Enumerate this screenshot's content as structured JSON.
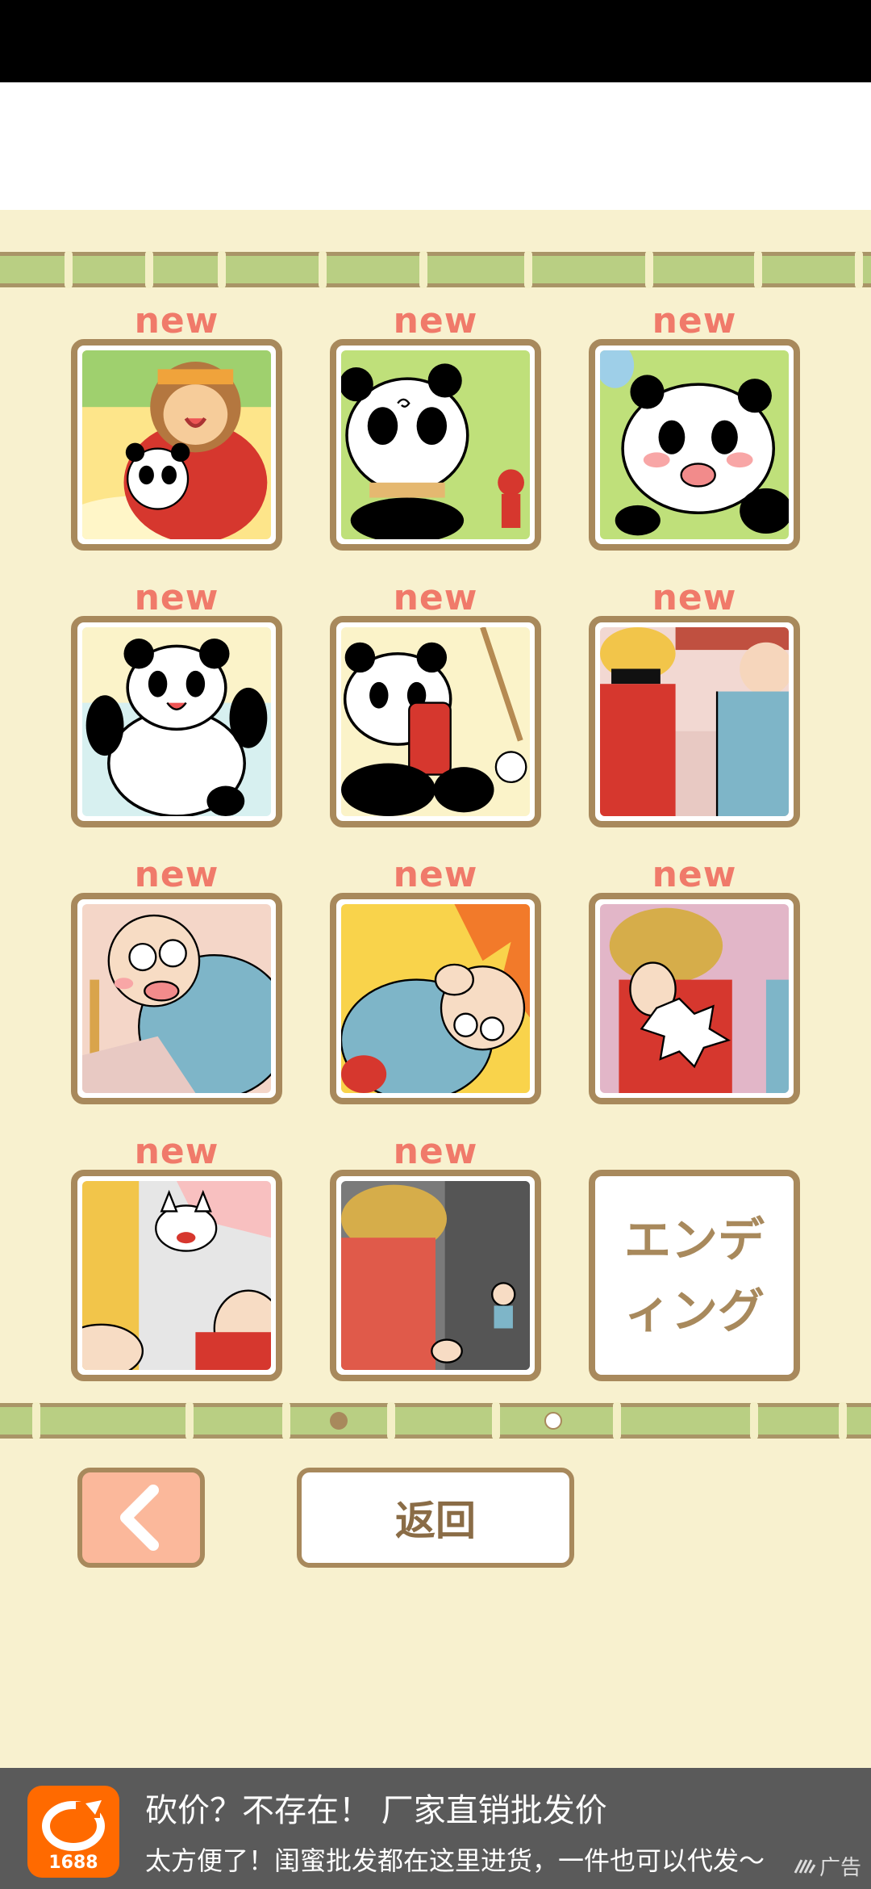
{
  "gallery": {
    "items": [
      {
        "badge": "new",
        "art": "wukong-holding-panda"
      },
      {
        "badge": "new",
        "art": "dizzy-panda"
      },
      {
        "badge": "new",
        "art": "crying-panda"
      },
      {
        "badge": "new",
        "art": "happy-panda"
      },
      {
        "badge": "new",
        "art": "panda-with-barrel"
      },
      {
        "badge": "new",
        "art": "workers-in-red-and-blue"
      },
      {
        "badge": "new",
        "art": "knocked-out-old-man"
      },
      {
        "badge": "new",
        "art": "old-man-on-fire"
      },
      {
        "badge": "new",
        "art": "punched-worker"
      },
      {
        "badge": "new",
        "art": "angry-cat"
      },
      {
        "badge": "new",
        "art": "worker-looking-down"
      }
    ],
    "ending_label": "エンディング"
  },
  "pagination": {
    "current_page": 2,
    "total_pages": 2
  },
  "buttons": {
    "back_icon": "chevron-left-icon",
    "return_label": "返回"
  },
  "ad": {
    "logo_text": "1688",
    "title": "砍价？不存在！ 厂家直销批发价",
    "subtitle": "太方便了！闺蜜批发都在这里进货，一件也可以代发～",
    "tag": "广告"
  },
  "colors": {
    "background": "#f8f1cf",
    "frame": "#a8895c",
    "new_badge": "#f07a6a",
    "bamboo": "#b9cf83",
    "back_button": "#fbb89b"
  }
}
